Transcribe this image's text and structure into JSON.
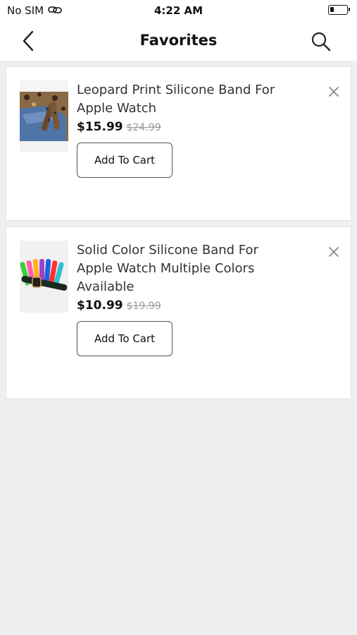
{
  "status_bar": {
    "carrier": "No SIM",
    "time": "4:22 AM",
    "battery_level": 0.22
  },
  "nav": {
    "title": "Favorites",
    "back_icon": "chevron-left-icon",
    "search_icon": "search-icon"
  },
  "favorites": [
    {
      "title": "Leopard Print Silicone Band For Apple Watch",
      "price": "$15.99",
      "original_price": "$24.99",
      "button_label": "Add To Cart"
    },
    {
      "title": "Solid Color Silicone Band For Apple Watch Multiple Colors Available",
      "price": "$10.99",
      "original_price": "$19.99",
      "button_label": "Add To Cart"
    }
  ],
  "colors": {
    "page_background": "#efefef",
    "card_background": "#ffffff",
    "old_price": "#999999"
  }
}
